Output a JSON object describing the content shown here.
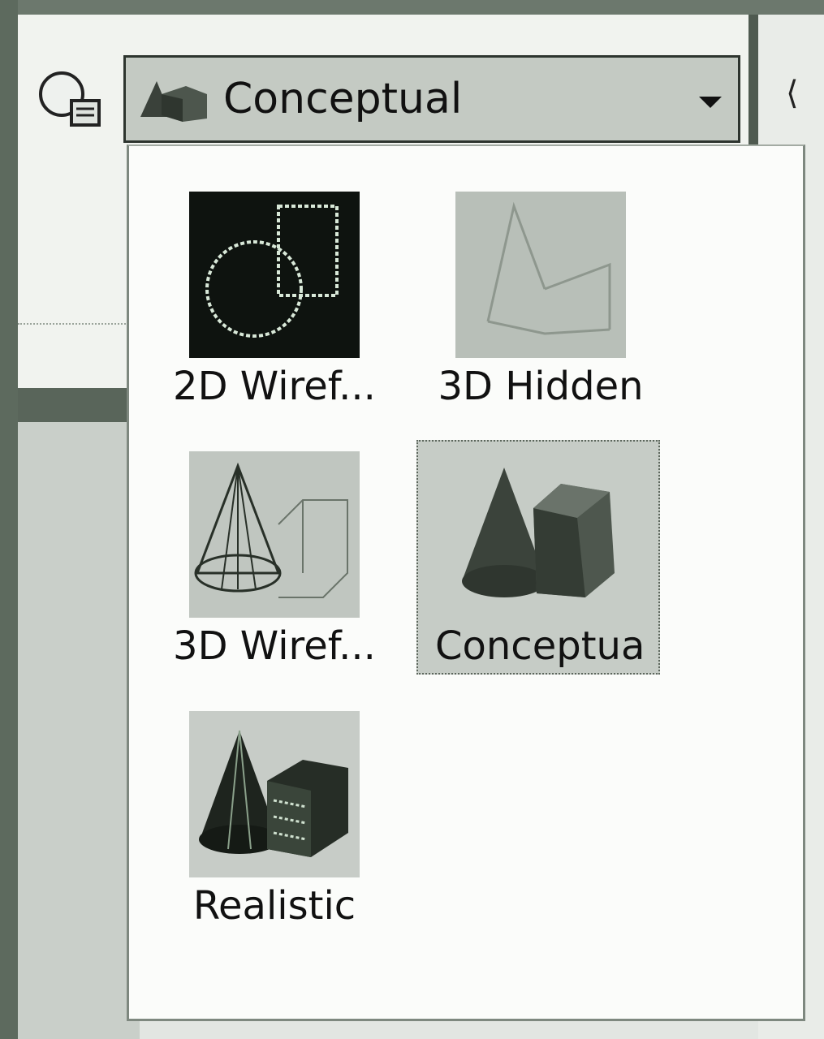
{
  "toolbar": {
    "icons": {
      "left": "visual-style-manager-icon",
      "right": "partial-left-glyph"
    },
    "right_glyph": "⟨"
  },
  "visual_style_combo": {
    "selected_label": "Conceptual",
    "thumbnail_icon": "conceptual-style-icon",
    "arrow_icon": "chevron-down-icon"
  },
  "visual_styles_menu": {
    "selected": "Conceptual",
    "items": [
      {
        "label": "2D Wiref...",
        "icon": "2d-wireframe-icon"
      },
      {
        "label": "3D Hidden",
        "icon": "3d-hidden-icon"
      },
      {
        "label": "3D Wiref...",
        "icon": "3d-wireframe-icon"
      },
      {
        "label": "Conceptual",
        "icon": "conceptual-icon"
      },
      {
        "label": "Realistic",
        "icon": "realistic-icon"
      }
    ]
  },
  "colors": {
    "wireframe_2d_bg": "#0e130f",
    "wireframe_lines": "#d8e8d8",
    "hidden_bg": "#b8bfb8",
    "selection_bg": "#c6ccc6",
    "menu_bg": "#fbfcfa"
  }
}
